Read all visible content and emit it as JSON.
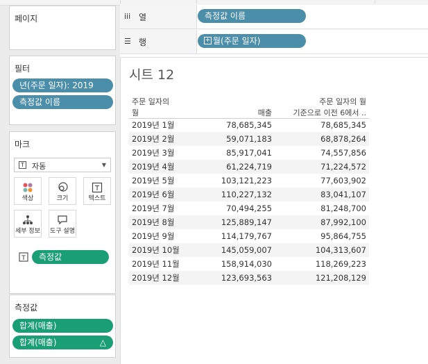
{
  "shelves": {
    "pages": {
      "title": "페이지"
    },
    "columns": {
      "label": "열",
      "pill": "측정값 이름"
    },
    "rows": {
      "label": "행",
      "pill": "월(주문 일자)"
    }
  },
  "filters": {
    "title": "필터",
    "pills": [
      "년(주문 일자): 2019",
      "측정값 이름"
    ]
  },
  "marks": {
    "title": "마크",
    "mark_type": "자동",
    "buttons": {
      "color": "색상",
      "size": "크기",
      "text": "텍스트",
      "detail": "세부 정보",
      "tooltip": "도구 설명"
    },
    "field_pill": "측정값",
    "colors": {
      "dot1": "#e15759",
      "dot2": "#b07aa1",
      "dot3": "#76b7b2",
      "dot4": "#f28e2b"
    }
  },
  "measure_values": {
    "title": "측정값",
    "pills": [
      "합계(매출)",
      "합계(매출)"
    ],
    "delta_icon": "△"
  },
  "view": {
    "sheet_title": "시트 12",
    "columns": [
      "주문 일자의 월",
      "매출",
      "주문 일자의 월 기준으로 이전 6에서 .."
    ],
    "header_col1_line1": "주문 일자의",
    "header_col1_line2": "월",
    "header_col3_line1": "주문 일자의 월",
    "header_col3_line2": "기준으로 이전 6에서 ..",
    "rows": [
      {
        "month": "2019년 1월",
        "sales": "78,685,345",
        "moving": "78,685,345"
      },
      {
        "month": "2019년 2월",
        "sales": "59,071,183",
        "moving": "68,878,264"
      },
      {
        "month": "2019년 3월",
        "sales": "85,917,041",
        "moving": "74,557,856"
      },
      {
        "month": "2019년 4월",
        "sales": "61,224,719",
        "moving": "71,224,572"
      },
      {
        "month": "2019년 5월",
        "sales": "103,121,223",
        "moving": "77,603,902"
      },
      {
        "month": "2019년 6월",
        "sales": "110,227,132",
        "moving": "83,041,107"
      },
      {
        "month": "2019년 7월",
        "sales": "70,494,255",
        "moving": "81,248,700"
      },
      {
        "month": "2019년 8월",
        "sales": "125,889,147",
        "moving": "87,992,100"
      },
      {
        "month": "2019년 9월",
        "sales": "114,179,767",
        "moving": "95,864,755"
      },
      {
        "month": "2019년 10월",
        "sales": "145,059,007",
        "moving": "104,313,607"
      },
      {
        "month": "2019년 11월",
        "sales": "158,914,030",
        "moving": "118,269,223"
      },
      {
        "month": "2019년 12월",
        "sales": "123,693,563",
        "moving": "121,208,129"
      }
    ]
  },
  "colors": {
    "dimension_pill": "#4b8ea9",
    "measure_pill": "#1a9e76"
  }
}
